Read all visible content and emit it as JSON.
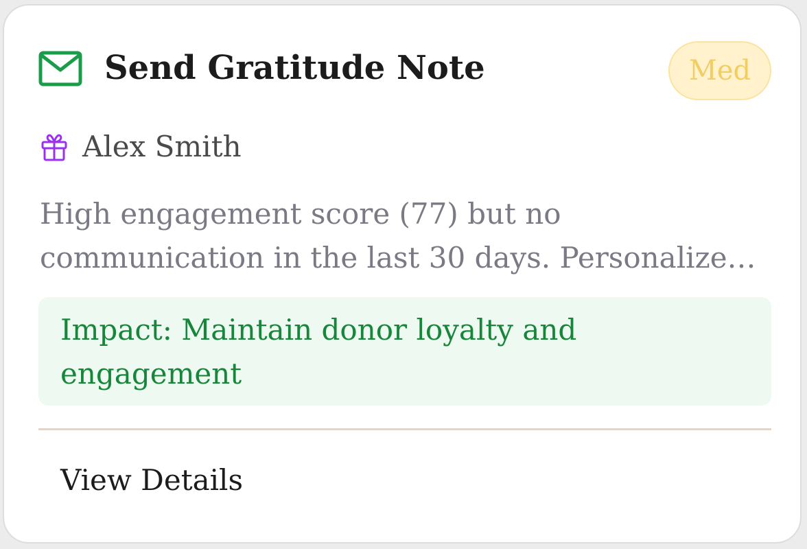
{
  "card": {
    "icon": "envelope-icon",
    "title": "Send Gratitude Note",
    "priority": "Med",
    "donor": {
      "icon": "gift-icon",
      "name": "Alex Smith"
    },
    "description": "High engagement score (77) but no communication in the last 30 days. Personalize…",
    "impact": "Impact: Maintain donor loyalty and engagement",
    "action_label": "View Details"
  },
  "colors": {
    "accent_green": "#1a9c4a",
    "gift_purple": "#9b30f2",
    "badge_background": "#fff2cc",
    "badge_text": "#f2cd63",
    "impact_background": "#eefaf1",
    "impact_text": "#17863b"
  }
}
